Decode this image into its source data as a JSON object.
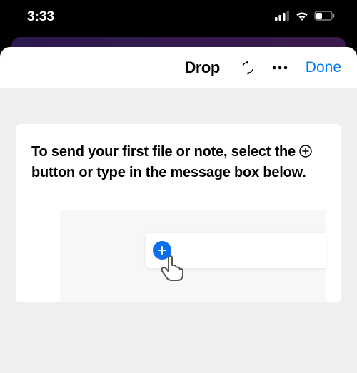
{
  "statusBar": {
    "time": "3:33"
  },
  "header": {
    "title": "Drop",
    "doneLabel": "Done"
  },
  "card": {
    "text_before": "To send your first file or note, select the ",
    "text_after": " button or type in the message box below."
  }
}
